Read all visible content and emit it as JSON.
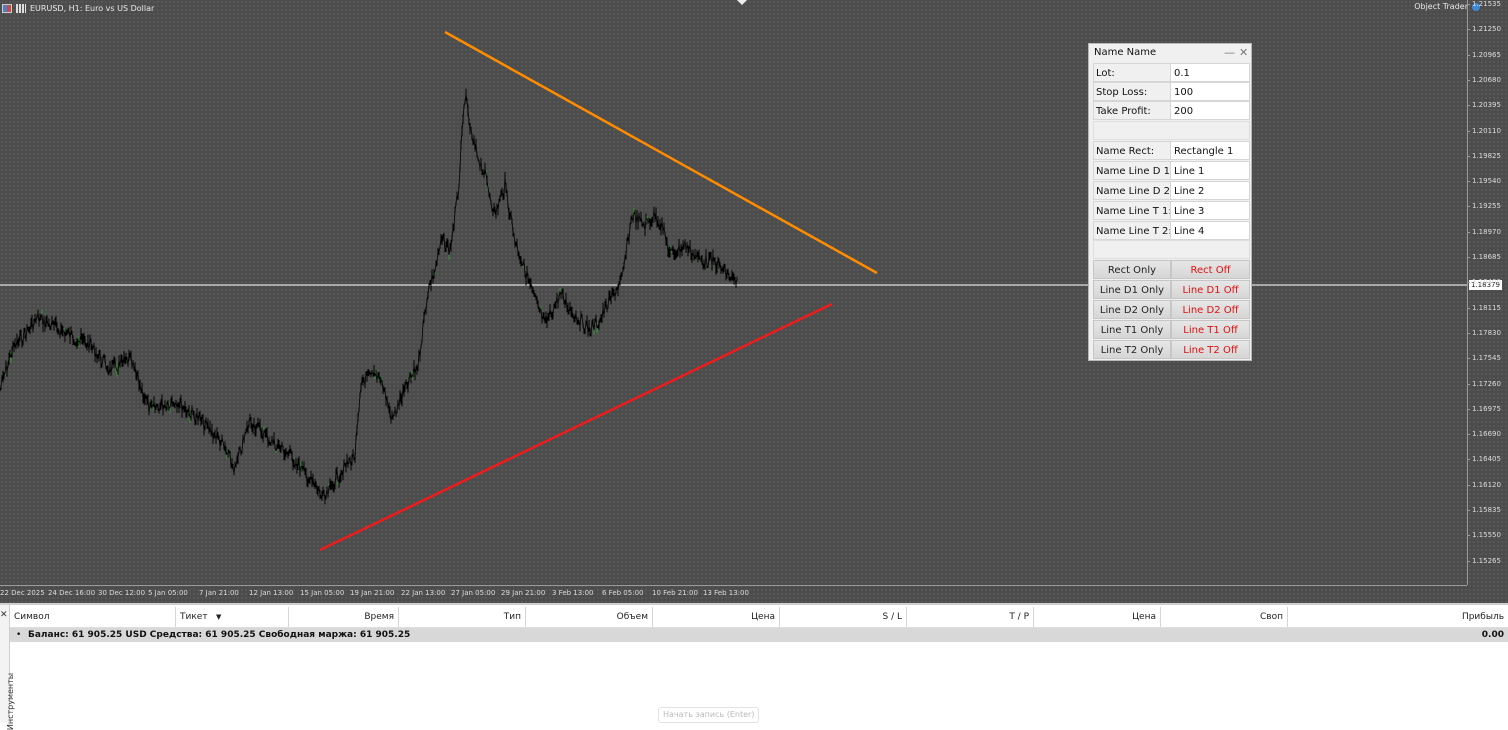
{
  "chart": {
    "symbol_label": "EURUSD, H1:  Euro vs US Dollar",
    "object_trader": "Object Trader",
    "current_price": "1.18379",
    "price_labels": [
      "1.21535",
      "1.21250",
      "1.20965",
      "1.20680",
      "1.20395",
      "1.20110",
      "1.19825",
      "1.19540",
      "1.19255",
      "1.18970",
      "1.18685",
      "1.18400",
      "1.18115",
      "1.17830",
      "1.17545",
      "1.17260",
      "1.16975",
      "1.16690",
      "1.16405",
      "1.16120",
      "1.15835",
      "1.15550",
      "1.15265"
    ],
    "time_labels": [
      "22 Dec 2025",
      "24 Dec 16:00",
      "30 Dec 12:00",
      "5 Jan 05:00",
      "7 Jan 21:00",
      "12 Jan 13:00",
      "15 Jan 05:00",
      "19 Jan 21:00",
      "22 Jan 13:00",
      "27 Jan 05:00",
      "29 Jan 21:00",
      "3 Feb 13:00",
      "6 Feb 05:00",
      "10 Feb 21:00",
      "13 Feb 13:00"
    ],
    "colors": {
      "upper_line": "#ff8c00",
      "lower_line": "#ee1c1c",
      "price_line": "#ffffff",
      "candles": "#000000",
      "bull_highlight": "#2e9b2e"
    }
  },
  "panel": {
    "title": "Name Name",
    "minimize": "—",
    "close": "✕",
    "fields": [
      {
        "label": "Lot:",
        "value": "0.1"
      },
      {
        "label": "Stop Loss:",
        "value": "100"
      },
      {
        "label": "Take Profit:",
        "value": "200"
      }
    ],
    "names": [
      {
        "label": "Name Rect:",
        "value": "Rectangle 1"
      },
      {
        "label": "Name Line D 1:",
        "value": "Line 1"
      },
      {
        "label": "Name Line D 2:",
        "value": "Line 2"
      },
      {
        "label": "Name Line T 1:",
        "value": "Line 3"
      },
      {
        "label": "Name Line T 2:",
        "value": "Line 4"
      }
    ],
    "buttons": [
      {
        "only": "Rect Only",
        "off": "Rect Off"
      },
      {
        "only": "Line D1 Only",
        "off": "Line D1 Off"
      },
      {
        "only": "Line D2 Only",
        "off": "Line D2 Off"
      },
      {
        "only": "Line T1 Only",
        "off": "Line T1 Off"
      },
      {
        "only": "Line T2 Only",
        "off": "Line T2 Off"
      }
    ]
  },
  "toolbox": {
    "close": "✕",
    "side_label": "Инструменты",
    "columns": [
      "Символ",
      "Тикет",
      "Время",
      "Тип",
      "Объем",
      "Цена",
      "S / L",
      "T / P",
      "Цена",
      "Своп",
      "Прибыль"
    ],
    "sort_icon": "▼",
    "balance_text": "Баланс: 61 905.25 USD  Средства: 61 905.25  Свободная маржа: 61 905.25",
    "profit": "0.00",
    "record_hint": "Начать запись (Enter)"
  }
}
